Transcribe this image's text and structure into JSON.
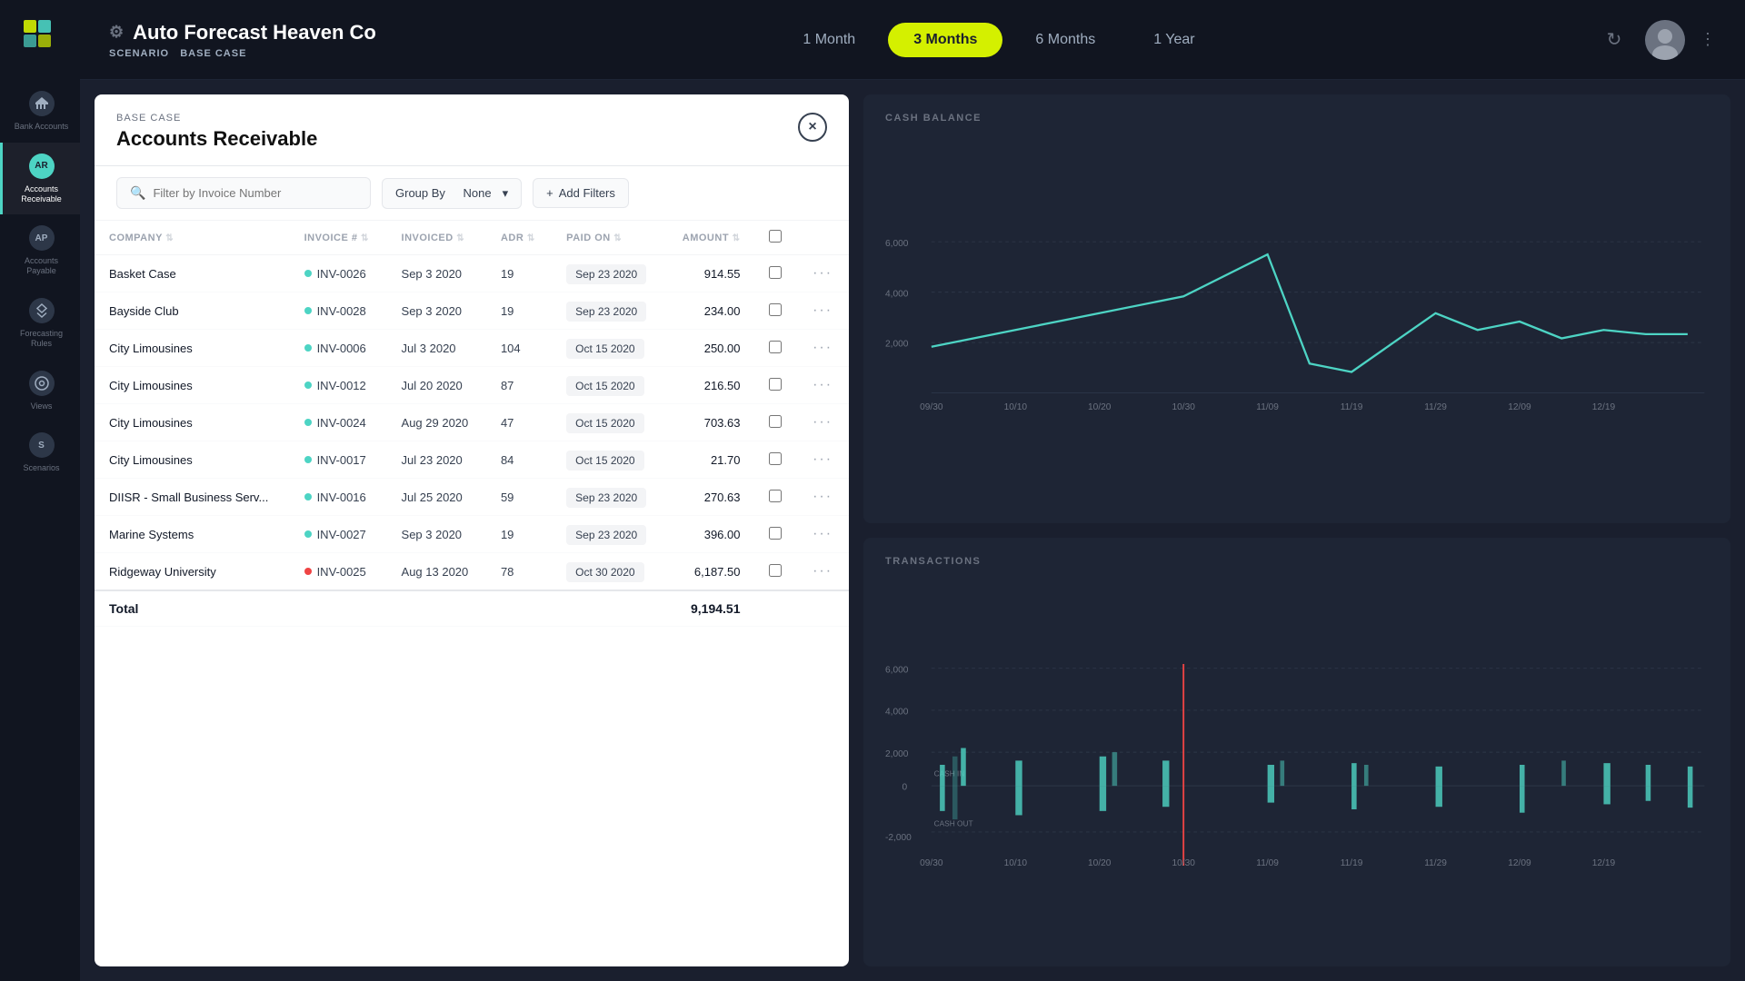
{
  "app": {
    "title": "Auto Forecast Heaven Co",
    "scenario_label": "SCENARIO",
    "scenario_value": "BASE CASE",
    "gear_icon": "⚙"
  },
  "nav": {
    "items": [
      {
        "label": "1 Month",
        "active": false
      },
      {
        "label": "3 Months",
        "active": true
      },
      {
        "label": "6 Months",
        "active": false
      },
      {
        "label": "1 Year",
        "active": false
      }
    ]
  },
  "sidebar": {
    "items": [
      {
        "id": "bank-accounts",
        "icon": "BA",
        "label": "Bank Accounts",
        "active": false
      },
      {
        "id": "accounts-receivable",
        "icon": "AR",
        "label": "Accounts Receivable",
        "active": true
      },
      {
        "id": "accounts-payable",
        "icon": "AP",
        "label": "Accounts Payable",
        "active": false
      },
      {
        "id": "forecasting-rules",
        "icon": "◇",
        "label": "Forecasting Rules",
        "active": false
      },
      {
        "id": "views",
        "icon": "◎",
        "label": "Views",
        "active": false
      },
      {
        "id": "scenarios",
        "icon": "S",
        "label": "Scenarios",
        "active": false
      }
    ]
  },
  "modal": {
    "scenario_label": "BASE CASE",
    "title": "Accounts Receivable",
    "close_label": "×",
    "filter_placeholder": "Filter by Invoice Number",
    "group_by_label": "Group By",
    "group_by_value": "None",
    "add_filters_label": "Add Filters",
    "columns": [
      {
        "label": "COMPANY",
        "key": "company"
      },
      {
        "label": "INVOICE #",
        "key": "invoice"
      },
      {
        "label": "INVOICED",
        "key": "invoiced"
      },
      {
        "label": "ADR",
        "key": "adr"
      },
      {
        "label": "PAID ON",
        "key": "paid_on"
      },
      {
        "label": "AMOUNT",
        "key": "amount"
      }
    ],
    "rows": [
      {
        "company": "Basket Case",
        "invoice": "INV-0026",
        "dot": "teal",
        "invoiced": "Sep 3 2020",
        "adr": "19",
        "paid_on": "Sep 23 2020",
        "amount": "914.55"
      },
      {
        "company": "Bayside Club",
        "invoice": "INV-0028",
        "dot": "teal",
        "invoiced": "Sep 3 2020",
        "adr": "19",
        "paid_on": "Sep 23 2020",
        "amount": "234.00"
      },
      {
        "company": "City Limousines",
        "invoice": "INV-0006",
        "dot": "teal",
        "invoiced": "Jul 3 2020",
        "adr": "104",
        "paid_on": "Oct 15 2020",
        "amount": "250.00"
      },
      {
        "company": "City Limousines",
        "invoice": "INV-0012",
        "dot": "teal",
        "invoiced": "Jul 20 2020",
        "adr": "87",
        "paid_on": "Oct 15 2020",
        "amount": "216.50"
      },
      {
        "company": "City Limousines",
        "invoice": "INV-0024",
        "dot": "teal",
        "invoiced": "Aug 29 2020",
        "adr": "47",
        "paid_on": "Oct 15 2020",
        "amount": "703.63"
      },
      {
        "company": "City Limousines",
        "invoice": "INV-0017",
        "dot": "teal",
        "invoiced": "Jul 23 2020",
        "adr": "84",
        "paid_on": "Oct 15 2020",
        "amount": "21.70"
      },
      {
        "company": "DIISR - Small Business Serv...",
        "invoice": "INV-0016",
        "dot": "teal",
        "invoiced": "Jul 25 2020",
        "adr": "59",
        "paid_on": "Sep 23 2020",
        "amount": "270.63"
      },
      {
        "company": "Marine Systems",
        "invoice": "INV-0027",
        "dot": "teal",
        "invoiced": "Sep 3 2020",
        "adr": "19",
        "paid_on": "Sep 23 2020",
        "amount": "396.00"
      },
      {
        "company": "Ridgeway University",
        "invoice": "INV-0025",
        "dot": "red",
        "invoiced": "Aug 13 2020",
        "adr": "78",
        "paid_on": "Oct 30 2020",
        "amount": "6,187.50"
      }
    ],
    "total_label": "Total",
    "total_amount": "9,194.51"
  },
  "cash_balance": {
    "title": "CASH BALANCE",
    "y_labels": [
      "6,000",
      "4,000",
      "2,000"
    ],
    "x_labels": [
      "09/30",
      "10/10",
      "10/20",
      "10/30",
      "11/09",
      "11/19",
      "11/29",
      "12/09",
      "12/19"
    ]
  },
  "transactions": {
    "title": "TRANSACTIONS",
    "y_labels": [
      "6,000",
      "4,000",
      "2,000",
      "0",
      "-2,000"
    ],
    "x_labels": [
      "09/30",
      "10/10",
      "10/20",
      "10/30",
      "11/09",
      "11/19",
      "11/29",
      "12/09",
      "12/19"
    ],
    "cash_in_label": "CASH IN",
    "cash_out_label": "CASH OUT"
  }
}
